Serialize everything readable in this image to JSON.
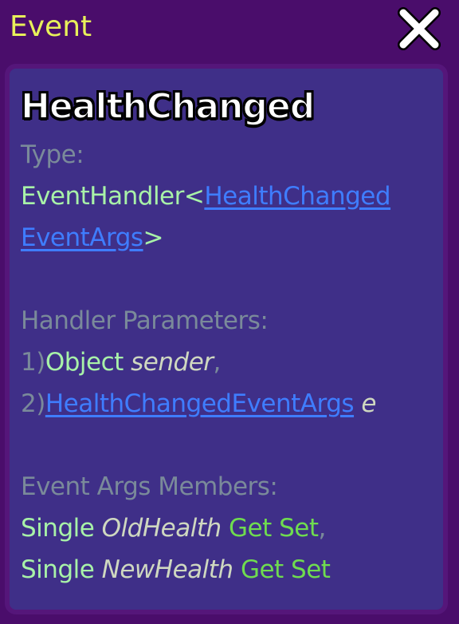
{
  "window": {
    "title": "Event",
    "close_icon": "close-x-icon"
  },
  "event": {
    "name": "HealthChanged",
    "type_label": "Type:",
    "type_prefix": "EventHandler<",
    "type_link_part1": "HealthChanged",
    "type_link_part2": "EventArgs",
    "type_suffix": ">",
    "handler_params_label": "Handler Parameters:",
    "params": [
      {
        "index": "1)",
        "type": "Object",
        "name": "sender",
        "sep": ","
      },
      {
        "index": "2)",
        "type": "HealthChangedEventArgs",
        "name": "e",
        "sep": ""
      }
    ],
    "members_label": "Event Args Members:",
    "members": [
      {
        "type": "Single",
        "name": "OldHealth",
        "access": "Get Set",
        "sep": ","
      },
      {
        "type": "Single",
        "name": "NewHealth",
        "access": "Get Set",
        "sep": ""
      }
    ]
  },
  "colors": {
    "background": "#4a0d6b",
    "panel": "#3f2f88",
    "title": "#e8f05a",
    "label": "#7a8a9a",
    "type": "#a8f2a8",
    "link": "#3f7dff",
    "accessor": "#6fdc4f"
  }
}
